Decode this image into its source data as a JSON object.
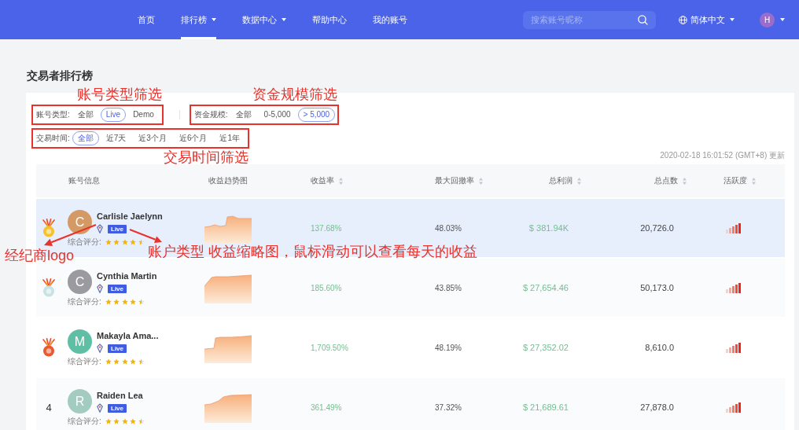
{
  "nav": {
    "items": [
      {
        "label": "首页",
        "selected": false,
        "dropdown": false
      },
      {
        "label": "排行榜",
        "selected": true,
        "dropdown": true
      },
      {
        "label": "数据中心",
        "selected": false,
        "dropdown": true
      },
      {
        "label": "帮助中心",
        "selected": false,
        "dropdown": false
      },
      {
        "label": "我的账号",
        "selected": false,
        "dropdown": false
      }
    ],
    "search": {
      "placeholder": "搜索账号昵称"
    },
    "language": {
      "label": "简体中文"
    },
    "user": {
      "initial": "H"
    }
  },
  "page_title": "交易者排行榜",
  "filters": [
    {
      "label": "账号类型:",
      "annotation": "账号类型筛选",
      "options": [
        {
          "label": "全部",
          "selected": false
        },
        {
          "label": "Live",
          "selected": true
        },
        {
          "label": "Demo",
          "selected": false
        }
      ]
    },
    {
      "label": "资金规模:",
      "annotation": "资金规模筛选",
      "options": [
        {
          "label": "全部",
          "selected": false
        },
        {
          "label": "0-5,000",
          "selected": false
        },
        {
          "label": "> 5,000",
          "selected": true
        }
      ]
    },
    {
      "label": "交易时间:",
      "annotation": "交易时间筛选",
      "options": [
        {
          "label": "全部",
          "selected": true
        },
        {
          "label": "近7天",
          "selected": false
        },
        {
          "label": "近3个月",
          "selected": false
        },
        {
          "label": "近6个月",
          "selected": false
        },
        {
          "label": "近1年",
          "selected": false
        }
      ]
    }
  ],
  "updated": "2020-02-18 16:01:52 (GMT+8) 更新",
  "table": {
    "columns": [
      {
        "label": "账号信息",
        "sortable": false
      },
      {
        "label": "收益趋势图",
        "sortable": false
      },
      {
        "label": "收益率",
        "sortable": true
      },
      {
        "label": "最大回撤率",
        "sortable": true
      },
      {
        "label": "总利润",
        "sortable": true
      },
      {
        "label": "总点数",
        "sortable": true
      },
      {
        "label": "活跃度",
        "sortable": true
      }
    ],
    "rows": [
      {
        "hovered": true,
        "rank": {
          "kind": "medal",
          "color": "#f6c12a"
        },
        "avatar": {
          "letter": "C",
          "color": "#d49a66"
        },
        "name": "Carlisle Jaelynn",
        "account_type": "Live",
        "rating_label": "综合评分:",
        "stars": 4.5,
        "return_rate": "137.68%",
        "max_drawdown": "48.03%",
        "total_profit": "$ 381.94K",
        "total_points": "20,726.0"
      },
      {
        "hovered": false,
        "rank": {
          "kind": "medal",
          "color": "#c9e2e4"
        },
        "avatar": {
          "letter": "C",
          "color": "#9b9b9f"
        },
        "name": "Cynthia Martin",
        "account_type": "Live",
        "rating_label": "综合评分:",
        "stars": 4.5,
        "return_rate": "185.60%",
        "max_drawdown": "43.85%",
        "total_profit": "$ 27,654.46",
        "total_points": "50,173.0"
      },
      {
        "hovered": false,
        "rank": {
          "kind": "medal",
          "color": "#e9582e"
        },
        "avatar": {
          "letter": "M",
          "color": "#5fbfa5"
        },
        "name": "Makayla Ama...",
        "account_type": "Live",
        "rating_label": "综合评分:",
        "stars": 4.5,
        "return_rate": "1,709.50%",
        "max_drawdown": "48.19%",
        "total_profit": "$ 27,352.02",
        "total_points": "8,610.0"
      },
      {
        "hovered": false,
        "rank": {
          "kind": "number",
          "text": "4"
        },
        "avatar": {
          "letter": "R",
          "color": "#a3cbbf"
        },
        "name": "Raiden Lea",
        "account_type": "Live",
        "rating_label": "综合评分:",
        "stars": 4.5,
        "return_rate": "361.49%",
        "max_drawdown": "37.32%",
        "total_profit": "$ 21,689.61",
        "total_points": "27,878.0"
      }
    ]
  },
  "callouts": [
    {
      "text": "经纪商logo"
    },
    {
      "text": "账户类型 收益缩略图，鼠标滑动可以查看每天的收益"
    }
  ]
}
